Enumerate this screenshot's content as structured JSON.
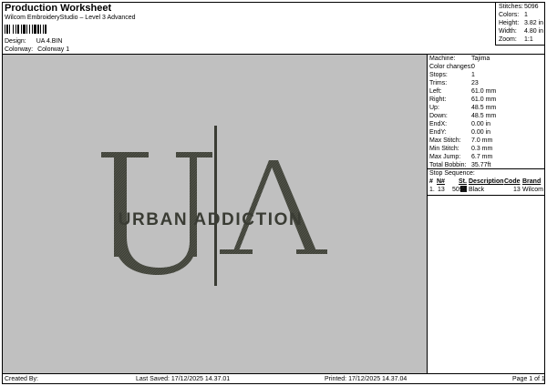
{
  "header": {
    "title": "Production Worksheet",
    "subtitle": "Wilcom EmbroideryStudio – Level 3 Advanced",
    "design_label": "Design:",
    "design_value": "UA 4.BIN",
    "colorway_label": "Colorway:",
    "colorway_value": "Colorway 1"
  },
  "stats": [
    {
      "label": "Stitches:",
      "value": "5096"
    },
    {
      "label": "Colors:",
      "value": "1"
    },
    {
      "label": "Height:",
      "value": "3.82 in"
    },
    {
      "label": "Width:",
      "value": "4.80 in"
    },
    {
      "label": "Zoom:",
      "value": "1:1"
    }
  ],
  "design": {
    "letter_u": "U",
    "letter_a": "A",
    "tagline": "URBAN ADDICTION",
    "thread_color": "#3a3c34",
    "background": "#c0c0c0"
  },
  "machine": [
    {
      "label": "Machine:",
      "value": "Tajima"
    },
    {
      "label": "Color changes:",
      "value": "0"
    },
    {
      "label": "Stops:",
      "value": "1"
    },
    {
      "label": "Trims:",
      "value": "23"
    },
    {
      "label": "Left:",
      "value": "61.0 mm"
    },
    {
      "label": "Right:",
      "value": "61.0 mm"
    },
    {
      "label": "Up:",
      "value": "48.5 mm"
    },
    {
      "label": "Down:",
      "value": "48.5 mm"
    },
    {
      "label": "EndX:",
      "value": "0.00 in"
    },
    {
      "label": "EndY:",
      "value": "0.00 in"
    },
    {
      "label": "Max Stitch:",
      "value": "7.0 mm"
    },
    {
      "label": "Min Stitch:",
      "value": "0.3 mm"
    },
    {
      "label": "Max Jump:",
      "value": "6.7 mm"
    },
    {
      "label": "Total Bobbin:",
      "value": "35.77ft"
    }
  ],
  "stop_sequence": {
    "title": "Stop Sequence:",
    "headers": {
      "num": "#",
      "n": "N#",
      "st": "St.",
      "description": "Description",
      "code": "Code",
      "brand": "Brand"
    },
    "rows": [
      {
        "num": "1.",
        "n": "13",
        "st": "5094",
        "description": "Black",
        "code": "13",
        "brand": "Wilcom",
        "swatch": "#1a1a1a"
      }
    ]
  },
  "footer": {
    "created_by": "Created By:",
    "last_saved": "Last Saved: 17/12/2025 14.37.01",
    "printed": "Printed: 17/12/2025 14.37.04",
    "page": "Page 1 of 1"
  }
}
